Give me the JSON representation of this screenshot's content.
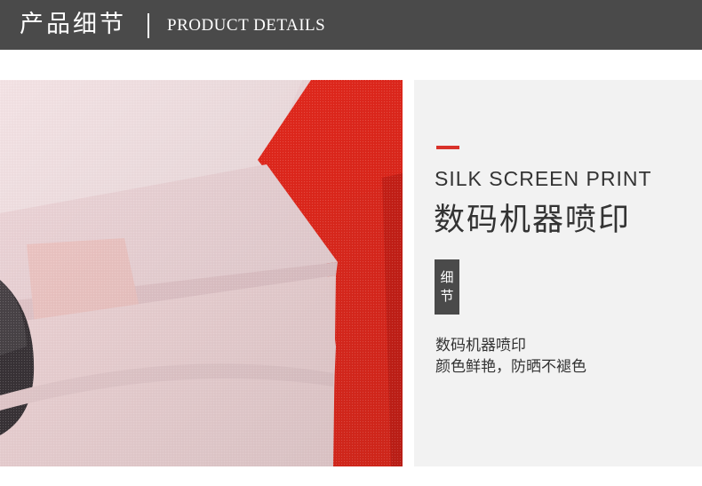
{
  "header": {
    "title_cn": "产品细节",
    "title_en": "PRODUCT DETAILS"
  },
  "panel": {
    "title_en": "SILK SCREEN PRINT",
    "title_cn": "数码机器喷印",
    "badge": [
      "细",
      "节"
    ],
    "description": [
      "数码机器喷印",
      "颜色鲜艳，防晒不褪色"
    ]
  },
  "colors": {
    "header_bg": "#4a4a4a",
    "accent": "#d9322a",
    "panel_bg": "#f2f2f2",
    "fabric_pink": "#f0d9dc",
    "fabric_red": "#e8281c",
    "fabric_dark": "#3a3438"
  }
}
